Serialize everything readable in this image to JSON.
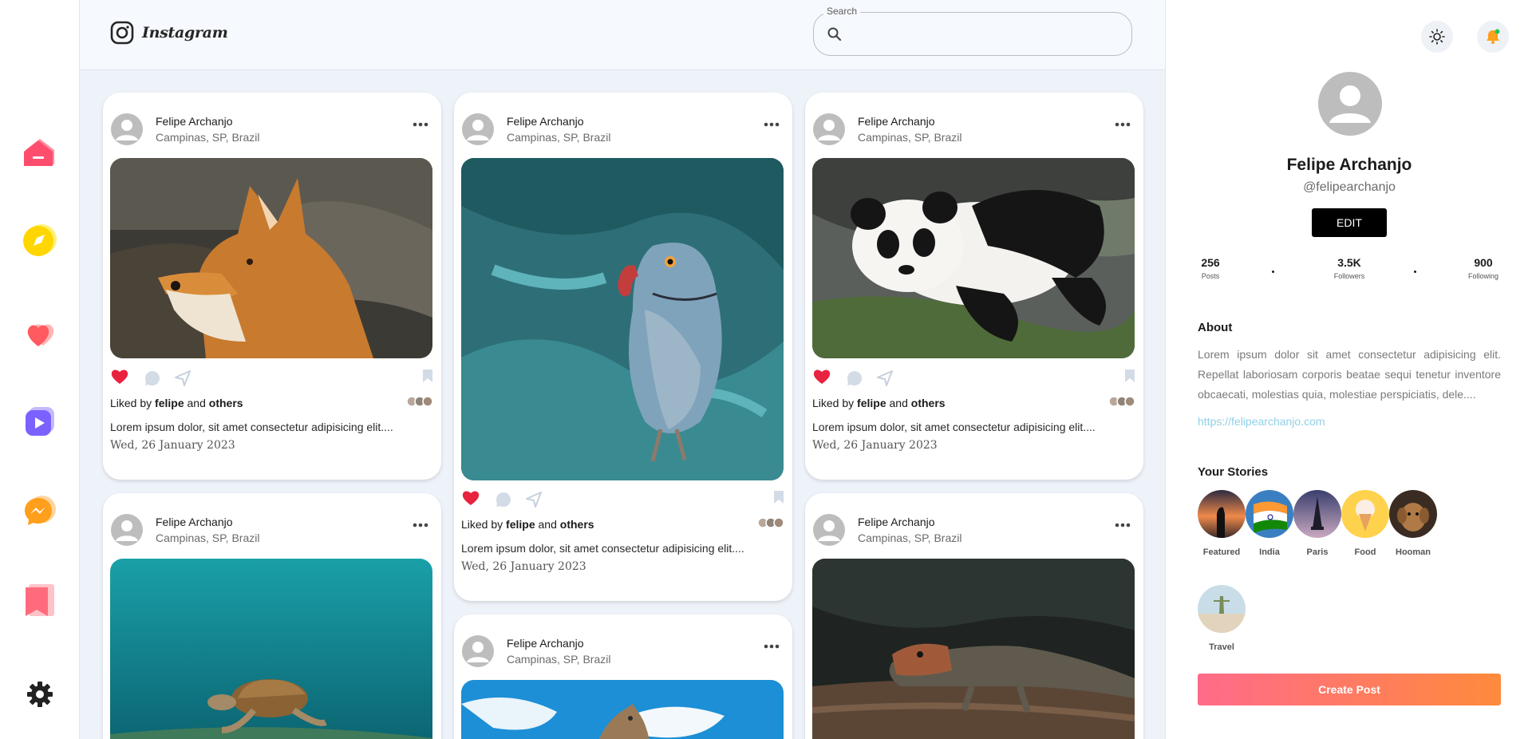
{
  "app": {
    "logo_text": "Instagram"
  },
  "header": {
    "search_label": "Search",
    "search_value": ""
  },
  "nav": {
    "items": [
      {
        "icon": "home-icon",
        "color": "#ff4d6d"
      },
      {
        "icon": "explore-icon",
        "color": "#ffd600"
      },
      {
        "icon": "likes-icon",
        "color": "#ff5a5f"
      },
      {
        "icon": "reels-icon",
        "color": "#7b61ff"
      },
      {
        "icon": "messenger-icon",
        "color": "#ff9f1c"
      },
      {
        "icon": "saved-icon",
        "color": "#ff6b7d"
      },
      {
        "icon": "settings-icon",
        "color": "#222222"
      }
    ]
  },
  "posts": [
    {
      "author": "Felipe Archanjo",
      "location": "Campinas, SP, Brazil",
      "image": "fox",
      "liked": true,
      "liked_prefix": "Liked by ",
      "liked_user": "felipe",
      "liked_and": " and ",
      "liked_others": "others",
      "caption": "Lorem ipsum dolor, sit amet consectetur adipisicing elit....",
      "date": "Wed, 26 January 2023"
    },
    {
      "author": "Felipe Archanjo",
      "location": "Campinas, SP, Brazil",
      "image": "parrot",
      "liked": true,
      "liked_prefix": "Liked by ",
      "liked_user": "felipe",
      "liked_and": " and ",
      "liked_others": "others",
      "caption": "Lorem ipsum dolor, sit amet consectetur adipisicing elit....",
      "date": "Wed, 26 January 2023"
    },
    {
      "author": "Felipe Archanjo",
      "location": "Campinas, SP, Brazil",
      "image": "panda",
      "liked": true,
      "liked_prefix": "Liked by ",
      "liked_user": "felipe",
      "liked_and": " and ",
      "liked_others": "others",
      "caption": "Lorem ipsum dolor, sit amet consectetur adipisicing elit....",
      "date": "Wed, 26 January 2023"
    },
    {
      "author": "Felipe Archanjo",
      "location": "Campinas, SP, Brazil",
      "image": "turtle"
    },
    {
      "author": "Felipe Archanjo",
      "location": "Campinas, SP, Brazil",
      "image": "giraffe"
    },
    {
      "author": "Felipe Archanjo",
      "location": "Campinas, SP, Brazil",
      "image": "lizard"
    }
  ],
  "profile": {
    "name": "Felipe Archanjo",
    "handle": "@felipearchanjo",
    "edit_label": "EDIT",
    "stats": [
      {
        "value": "256",
        "label": "Posts"
      },
      {
        "value": "3.5K",
        "label": "Followers"
      },
      {
        "value": "900",
        "label": "Following"
      }
    ],
    "about_title": "About",
    "about_text": "Lorem ipsum dolor sit amet consectetur adipisicing elit. Repellat laboriosam corporis beatae sequi tenetur inventore obcaecati, molestias quia, molestiae perspiciatis, dele....",
    "link": "https://felipearchanjo.com",
    "stories_title": "Your Stories",
    "stories": [
      {
        "label": "Featured"
      },
      {
        "label": "India"
      },
      {
        "label": "Paris"
      },
      {
        "label": "Food"
      },
      {
        "label": "Hooman"
      },
      {
        "label": "Travel"
      }
    ],
    "create_label": "Create Post"
  },
  "colors": {
    "accent_gradient_start": "#ff6b8a",
    "accent_gradient_end": "#ff8a3c",
    "like_red": "#e8233f",
    "link": "#8fd0e6",
    "notification_dot": "#22c55e"
  }
}
